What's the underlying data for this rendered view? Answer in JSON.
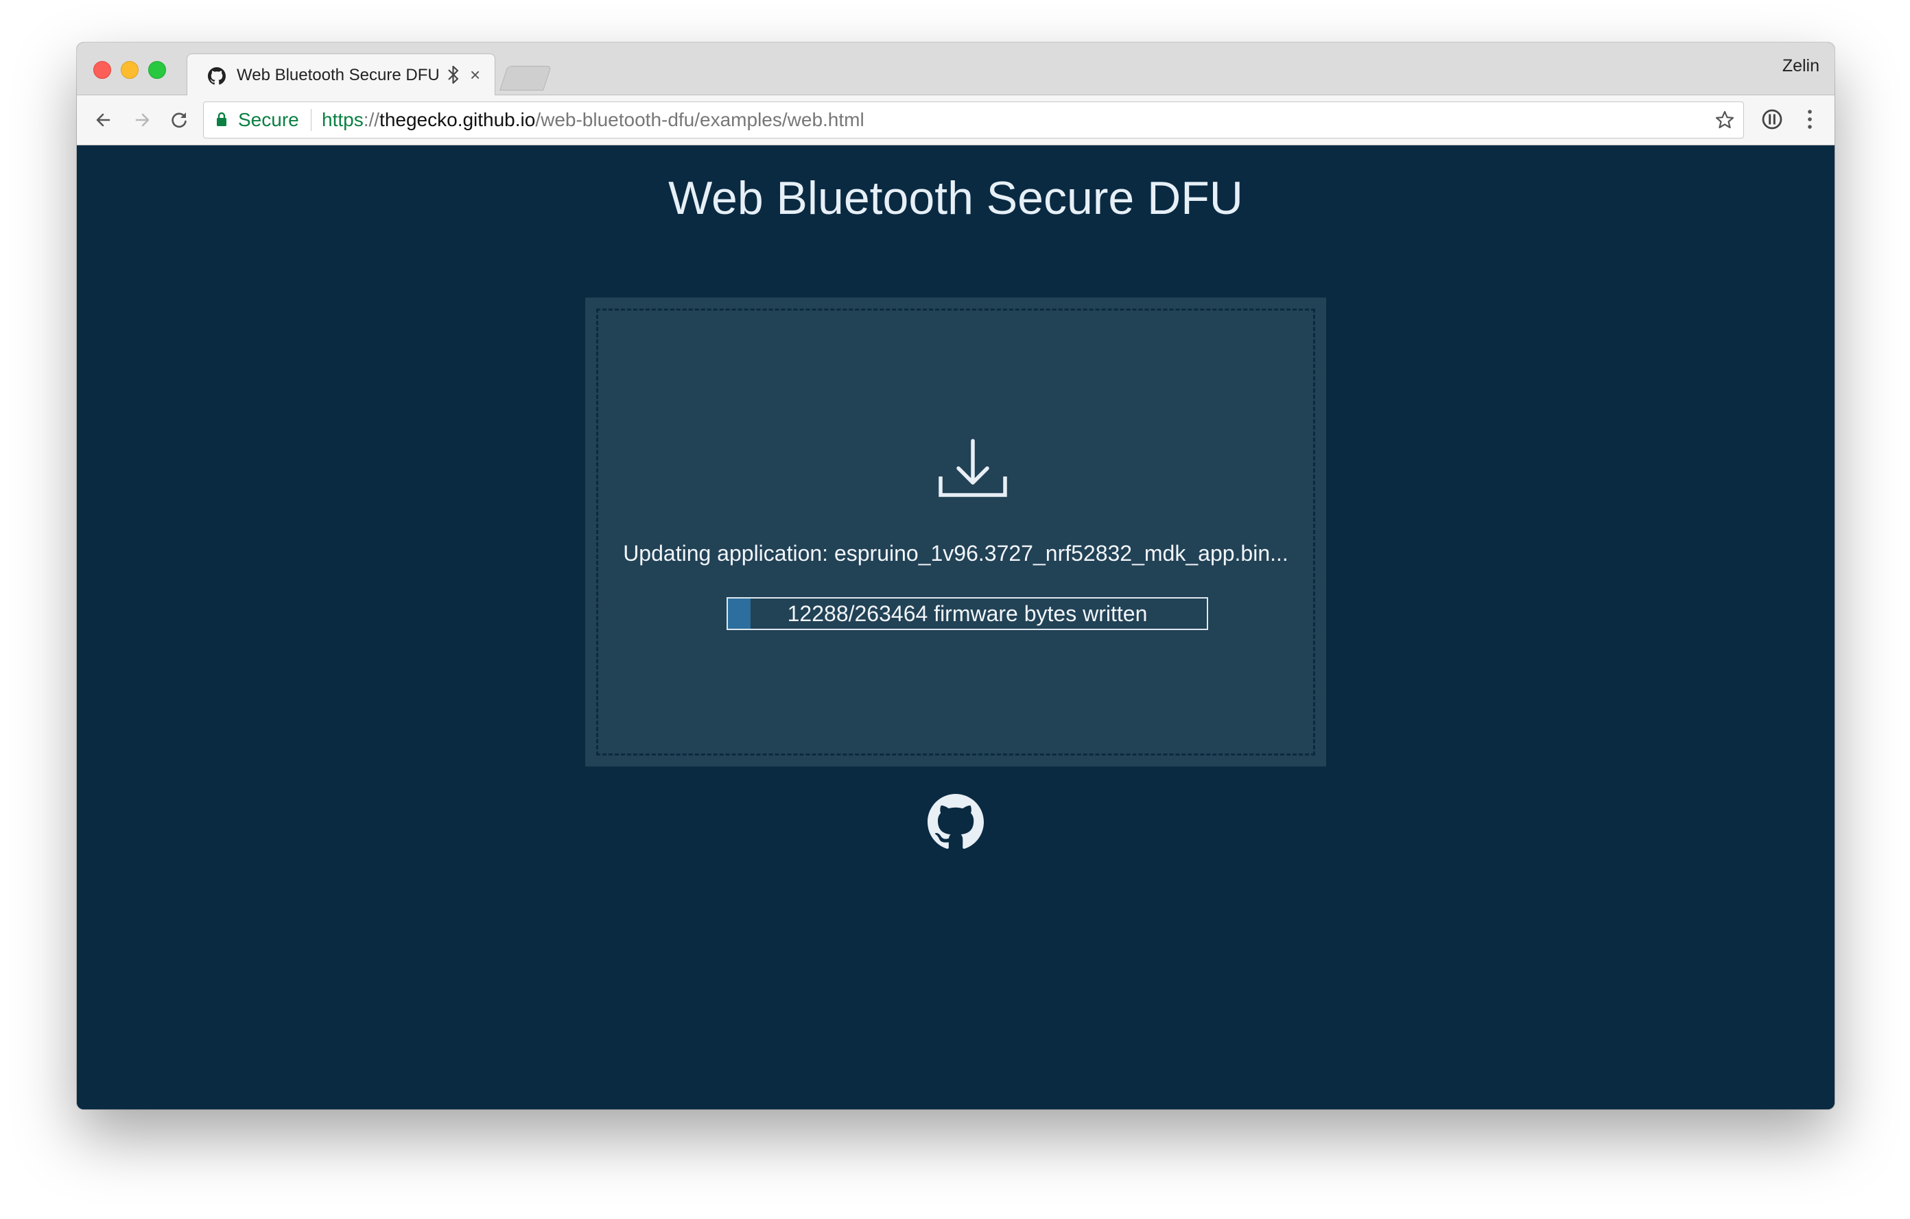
{
  "browser": {
    "tab": {
      "title": "Web Bluetooth Secure DFU",
      "favicon": "octocat-icon",
      "indicator": "bluetooth-icon",
      "close": "×"
    },
    "profile": "Zelin",
    "toolbar": {
      "back": "back-arrow-icon",
      "forward": "forward-arrow-icon",
      "reload": "reload-icon",
      "bookmark": "star-icon",
      "extension": "extension-icon",
      "menu": "kebab-menu-icon"
    },
    "omnibox": {
      "security_label": "Secure",
      "url_scheme": "https",
      "url_sep": "://",
      "url_host": "thegecko.github.io",
      "url_path": "/web-bluetooth-dfu/examples/web.html"
    }
  },
  "page": {
    "title": "Web Bluetooth Secure DFU",
    "dropzone": {
      "icon": "download-icon",
      "status": "Updating application: espruino_1v96.3727_nrf52832_mdk_app.bin...",
      "progress": {
        "label": "12288/263464 firmware bytes written",
        "written": 12288,
        "total": 263464,
        "fill_color": "#2c6e9d"
      }
    },
    "footer_icon": "github-icon"
  },
  "colors": {
    "page_background": "#0a2a42",
    "dropzone_background": "#224256",
    "secure_green": "#0b8043"
  }
}
